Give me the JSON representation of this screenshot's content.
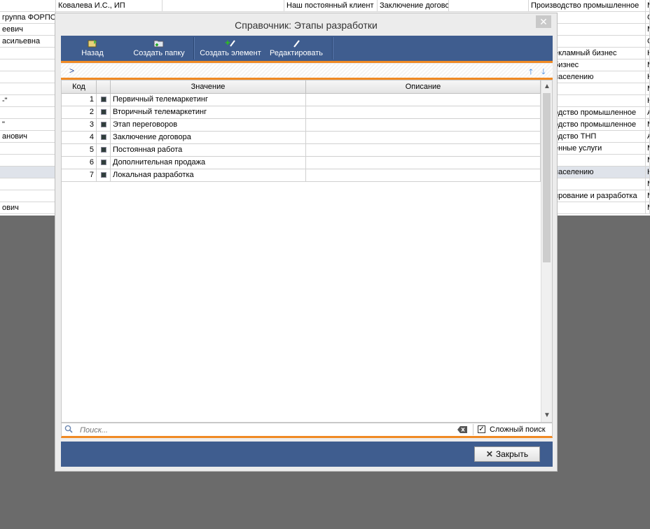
{
  "background": {
    "rows": [
      {
        "left": "",
        "mid1": "Ковалева И.С., ИП",
        "mid2": "Наш постоянный клиент",
        "mid3": "Заключение догово",
        "right": "Производство промышленное",
        "edge": "М"
      },
      {
        "left": "группа ФОРПОС",
        "right": "",
        "edge": "С"
      },
      {
        "left": "еевич",
        "right": "",
        "edge": "М"
      },
      {
        "left": "асильевна",
        "right": "",
        "edge": "С"
      },
      {
        "left": "",
        "right": "екламный бизнес",
        "edge": "Н"
      },
      {
        "left": "",
        "right": "бизнес",
        "edge": "М"
      },
      {
        "left": "",
        "right": "населению",
        "edge": "Н"
      },
      {
        "left": "",
        "right": "",
        "edge": "М"
      },
      {
        "left": "-\"",
        "right": "",
        "edge": "К"
      },
      {
        "left": "",
        "right": "одство промышленное",
        "edge": "А"
      },
      {
        "left": "\"",
        "right": "одство промышленное",
        "edge": "М"
      },
      {
        "left": "анович",
        "right": "одство ТНП",
        "edge": "А"
      },
      {
        "left": "",
        "right": "енные услуги",
        "edge": "М"
      },
      {
        "left": "",
        "right": "",
        "edge": "М"
      },
      {
        "left": "",
        "right": "населению",
        "edge": "К"
      },
      {
        "left": "",
        "right": "",
        "edge": "М"
      },
      {
        "left": "",
        "right": "ирование и разработка",
        "edge": "М"
      },
      {
        "left": "ович",
        "right": "",
        "edge": "М"
      }
    ]
  },
  "dialog": {
    "title": "Справочник: Этапы разработки",
    "close_glyph": "✕",
    "toolbar": {
      "back": "Назад",
      "create_folder": "Создать папку",
      "create_element": "Создать элемент",
      "edit": "Редактировать"
    },
    "path": ">",
    "table": {
      "headers": {
        "code": "Код",
        "value": "Значение",
        "description": "Описание"
      },
      "rows": [
        {
          "code": "1",
          "value": "Первичный телемаркетинг",
          "description": ""
        },
        {
          "code": "2",
          "value": "Вторичный телемаркетинг",
          "description": ""
        },
        {
          "code": "3",
          "value": "Этап переговоров",
          "description": ""
        },
        {
          "code": "4",
          "value": "Заключение договора",
          "description": ""
        },
        {
          "code": "5",
          "value": "Постоянная работа",
          "description": ""
        },
        {
          "code": "6",
          "value": "Дополнительная продажа",
          "description": ""
        },
        {
          "code": "7",
          "value": "Локальная разработка",
          "description": ""
        }
      ]
    },
    "search": {
      "placeholder": "Поиск...",
      "complex_search_label": "Сложный поиск",
      "complex_search_checked": true
    },
    "close_button": "Закрыть"
  }
}
